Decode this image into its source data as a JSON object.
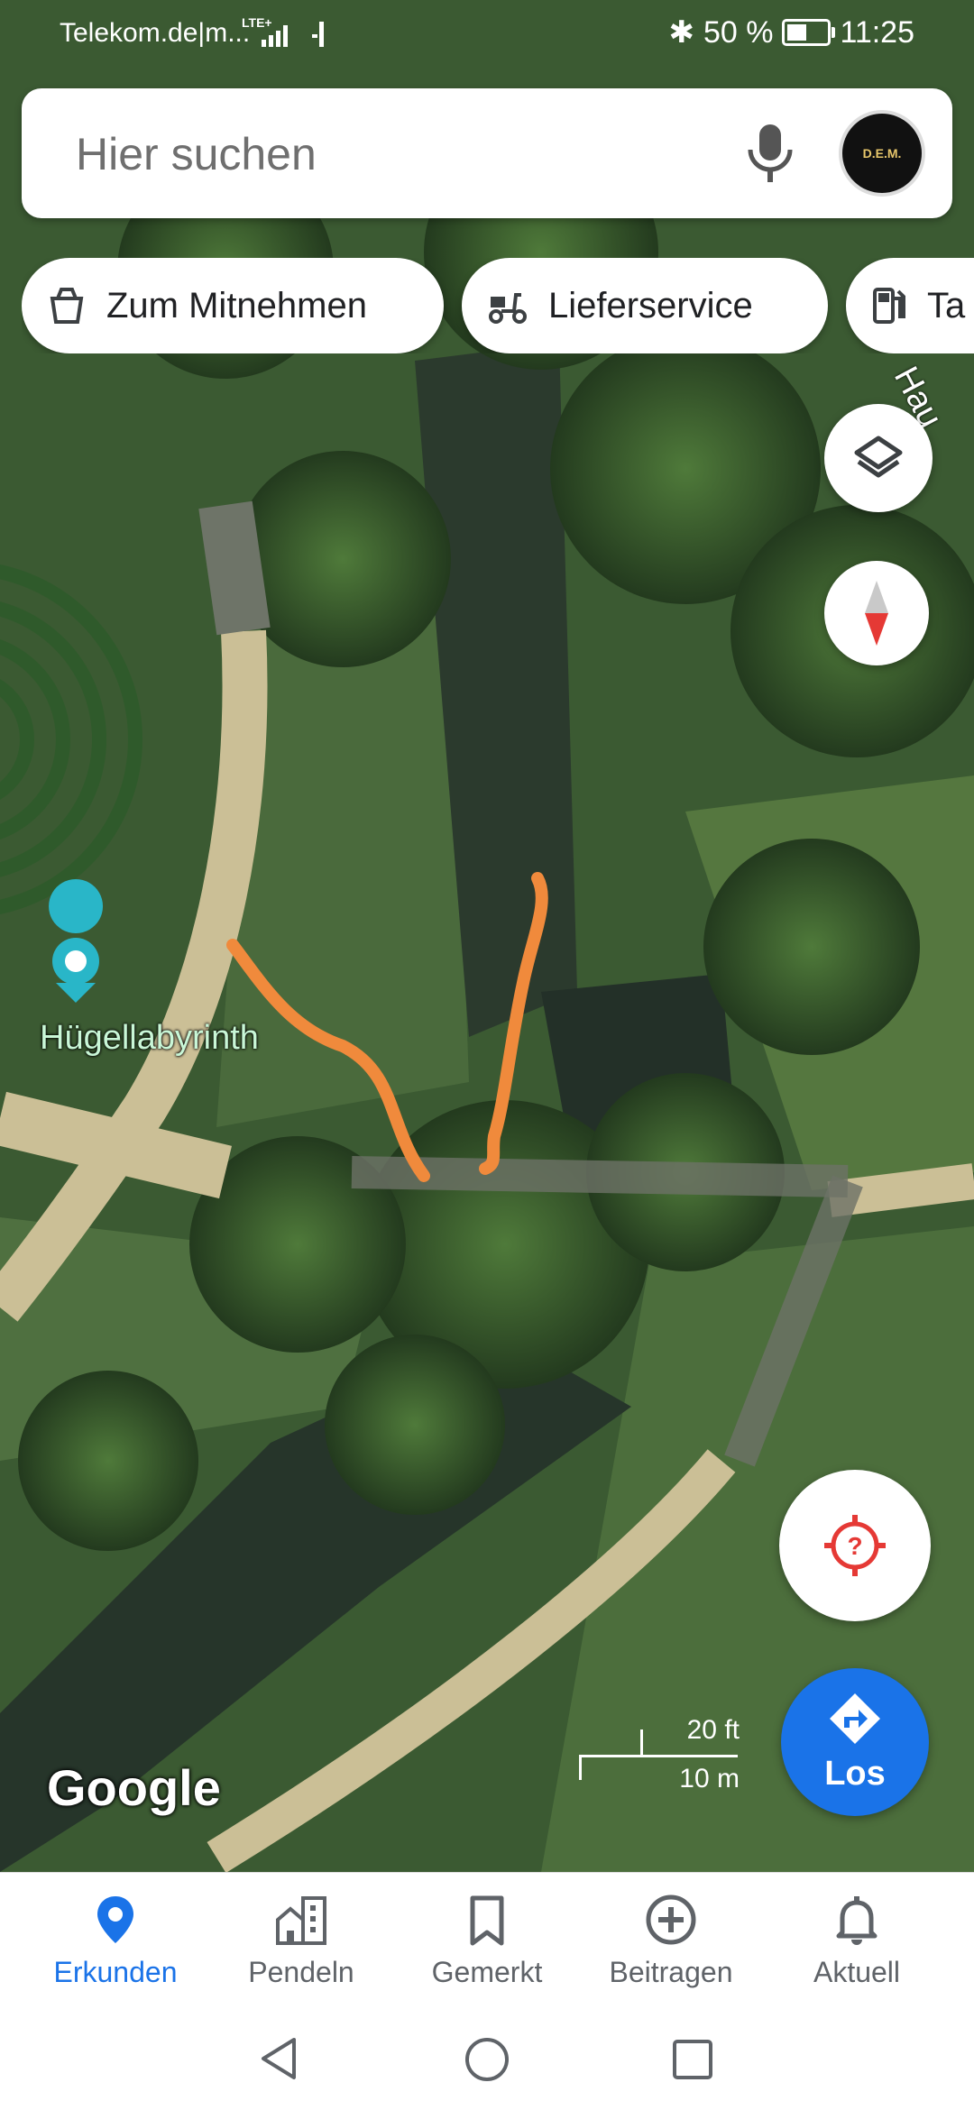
{
  "status_bar": {
    "carrier": "Telekom.de|m...",
    "network": "LTE+",
    "battery": "50 %",
    "battery_level": 0.5,
    "time": "11:25"
  },
  "search": {
    "placeholder": "Hier suchen"
  },
  "chips": [
    {
      "label": "Zum Mitnehmen",
      "icon": "takeout-bag-icon"
    },
    {
      "label": "Lieferservice",
      "icon": "delivery-scooter-icon"
    },
    {
      "label": "Ta",
      "icon": "gas-station-icon"
    }
  ],
  "map": {
    "place_label": "Hügellabyrinth",
    "road_label": "Hau",
    "attribution": "Google",
    "scale": {
      "imperial": "20 ft",
      "metric": "10 m"
    }
  },
  "fab": {
    "go_label": "Los"
  },
  "bottom_nav": [
    {
      "label": "Erkunden",
      "icon": "explore-pin-icon",
      "active": true
    },
    {
      "label": "Pendeln",
      "icon": "commute-buildings-icon",
      "active": false
    },
    {
      "label": "Gemerkt",
      "icon": "bookmark-icon",
      "active": false
    },
    {
      "label": "Beitragen",
      "icon": "add-circle-icon",
      "active": false
    },
    {
      "label": "Aktuell",
      "icon": "bell-icon",
      "active": false
    }
  ],
  "colors": {
    "accent": "#1a73e8",
    "annotation": "#f08a3c",
    "place_pin": "#29b6c8"
  }
}
